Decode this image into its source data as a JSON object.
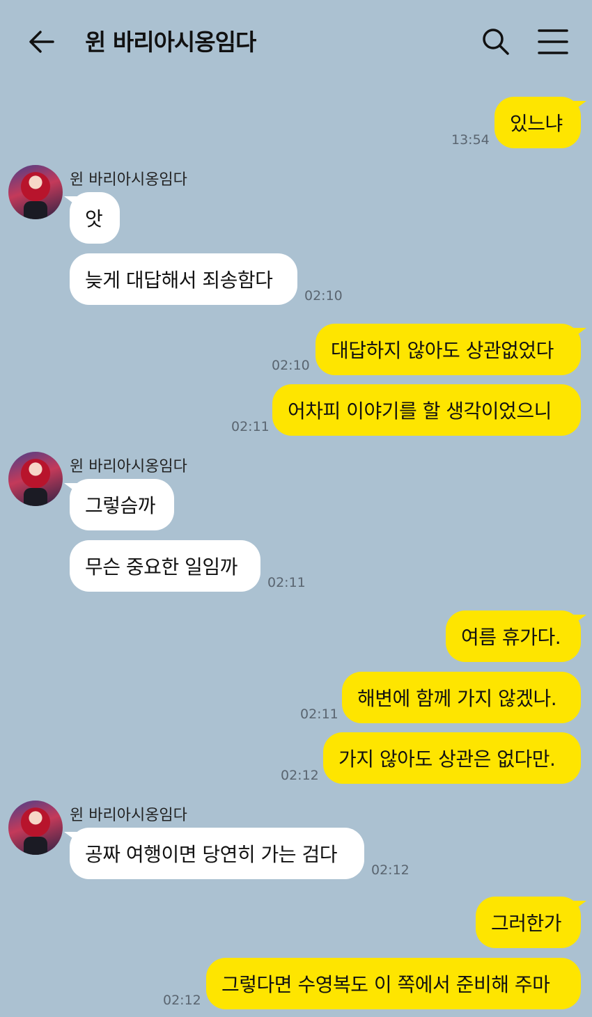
{
  "header": {
    "title": "윈 바리아시옹임다",
    "back_icon": "arrow-left-icon",
    "search_icon": "search-icon",
    "menu_icon": "hamburger-menu-icon"
  },
  "colors": {
    "background": "#abc1d1",
    "my_bubble": "#fee500",
    "their_bubble": "#ffffff"
  },
  "messages": [
    {
      "from": "me",
      "text": "있느냐"
    },
    {
      "from": "me_time",
      "text": "13:54"
    },
    {
      "from": "sender",
      "text": "윈 바리아시옹임다"
    },
    {
      "from": "them",
      "text": "앗"
    },
    {
      "from": "them",
      "text": "늦게 대답해서 죄송함다"
    },
    {
      "from": "them_time",
      "text": "02:10"
    },
    {
      "from": "me",
      "text": "대답하지 않아도 상관없었다"
    },
    {
      "from": "me_time",
      "text": "02:10"
    },
    {
      "from": "me",
      "text": "어차피 이야기를 할 생각이었으니"
    },
    {
      "from": "me_time",
      "text": "02:11"
    },
    {
      "from": "sender",
      "text": "윈 바리아시옹임다"
    },
    {
      "from": "them",
      "text": "그렇슴까"
    },
    {
      "from": "them",
      "text": "무슨 중요한 일임까"
    },
    {
      "from": "them_time",
      "text": "02:11"
    },
    {
      "from": "me",
      "text": "여름 휴가다."
    },
    {
      "from": "me",
      "text": "해변에 함께 가지 않겠나."
    },
    {
      "from": "me_time",
      "text": "02:11"
    },
    {
      "from": "me",
      "text": "가지 않아도 상관은 없다만."
    },
    {
      "from": "me_time",
      "text": "02:12"
    },
    {
      "from": "sender",
      "text": "윈 바리아시옹임다"
    },
    {
      "from": "them",
      "text": "공짜 여행이면 당연히 가는 검다"
    },
    {
      "from": "them_time",
      "text": "02:12"
    },
    {
      "from": "me",
      "text": "그러한가"
    },
    {
      "from": "me",
      "text": "그렇다면 수영복도 이 쪽에서 준비해 주마"
    },
    {
      "from": "me_time",
      "text": "02:12"
    }
  ]
}
